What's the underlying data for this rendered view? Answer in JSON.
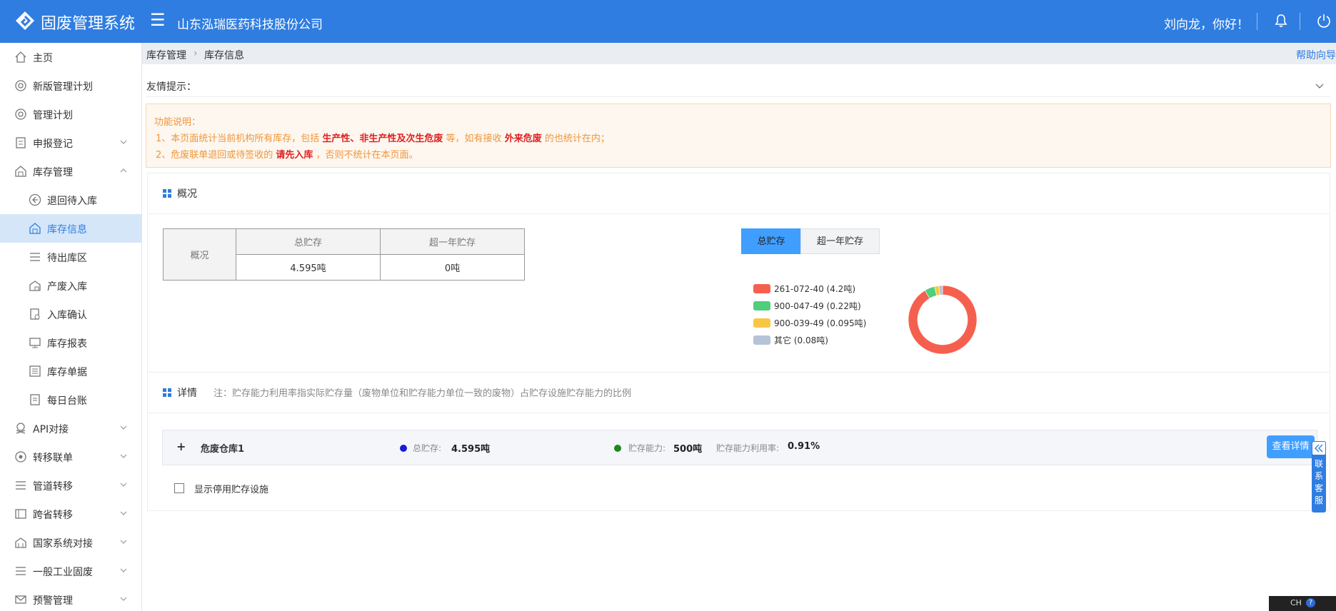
{
  "header": {
    "app_title": "固废管理系统",
    "company": "山东泓瑞医药科技股份公司",
    "greeting": "刘向龙，你好！",
    "icons": [
      "logo-icon",
      "menu-icon",
      "bell-icon",
      "power-icon"
    ],
    "brand_color": "#2f7de1"
  },
  "sidebar": {
    "items": [
      {
        "label": "主页",
        "icon": "home-icon"
      },
      {
        "label": "新版管理计划",
        "icon": "plan-icon"
      },
      {
        "label": "管理计划",
        "icon": "plan-icon"
      },
      {
        "label": "申报登记",
        "icon": "register-icon",
        "expandable": true
      },
      {
        "label": "库存管理",
        "icon": "warehouse-icon",
        "expanded": true
      },
      {
        "label": "退回待入库",
        "icon": "return-icon",
        "sub": true
      },
      {
        "label": "库存信息",
        "icon": "warehouse-icon",
        "sub": true,
        "active": true
      },
      {
        "label": "待出库区",
        "icon": "list-icon",
        "sub": true
      },
      {
        "label": "产废入库",
        "icon": "factory-icon",
        "sub": true
      },
      {
        "label": "入库确认",
        "icon": "confirm-icon",
        "sub": true
      },
      {
        "label": "库存报表",
        "icon": "report-icon",
        "sub": true
      },
      {
        "label": "库存单据",
        "icon": "doc-icon",
        "sub": true
      },
      {
        "label": "每日台账",
        "icon": "ledger-icon",
        "sub": true
      },
      {
        "label": "API对接",
        "icon": "api-icon",
        "expandable": true
      },
      {
        "label": "转移联单",
        "icon": "transfer-icon",
        "expandable": true
      },
      {
        "label": "管道转移",
        "icon": "pipe-icon",
        "expandable": true
      },
      {
        "label": "跨省转移",
        "icon": "cross-province-icon",
        "expandable": true
      },
      {
        "label": "国家系统对接",
        "icon": "national-icon",
        "expandable": true
      },
      {
        "label": "一般工业固废",
        "icon": "industrial-icon",
        "expandable": true
      },
      {
        "label": "预警管理",
        "icon": "alert-icon",
        "expandable": true
      }
    ]
  },
  "breadcrumb": {
    "items": [
      "库存管理",
      "库存信息"
    ],
    "help": "帮助向导"
  },
  "tips": {
    "label": "友情提示：",
    "title": "功能说明：",
    "line1": {
      "a": "1、本页面统计当前机构所有库存，包括 ",
      "b": "生产性、非生产性及次生危废",
      "c": " 等，如有接收 ",
      "d": "外来危废",
      "e": " 的也统计在内；"
    },
    "line2": {
      "a": "2、危废联单退回或待签收的 ",
      "b": "请先入库",
      "c": " ，否则不统计在本页面。"
    },
    "accent": "#f0953a",
    "highlight": "#e02020"
  },
  "overview": {
    "title": "概况",
    "table": {
      "row_label": "概况",
      "headers": [
        "总贮存",
        "超一年贮存"
      ],
      "values": [
        "4.595吨",
        "0吨"
      ]
    },
    "toggle": {
      "on": "总贮存",
      "off": "超一年贮存"
    }
  },
  "chart_data": {
    "type": "pie",
    "categories": [
      "261-072-40",
      "900-047-49",
      "900-039-49",
      "其它"
    ],
    "values": [
      4.2,
      0.22,
      0.095,
      0.08
    ],
    "legend_labels": [
      "261-072-40  (4.2吨)",
      "900-047-49  (0.22吨)",
      "900-039-49  (0.095吨)",
      "其它  (0.08吨)"
    ],
    "colors": [
      "#f5604e",
      "#4fce7c",
      "#f7c744",
      "#b6c2d6"
    ],
    "legend": "left"
  },
  "details": {
    "title": "详情",
    "note": "注：贮存能力利用率指实际贮存量（废物单位和贮存能力单位一致的废物）占贮存设施贮存能力的比例",
    "stores": [
      {
        "expand": "+",
        "name": "危废仓库1",
        "total_label": "总贮存:",
        "total": "4.595吨",
        "capacity_label": "贮存能力:",
        "capacity": "500吨",
        "usage_label": "贮存能力利用率:",
        "usage": "0.91%",
        "button": "查看详情"
      }
    ],
    "show_disabled_label": "显示停用贮存设施",
    "show_disabled_checked": false
  },
  "service": {
    "label": "联系客服"
  },
  "ime": {
    "lang": "CH",
    "help": "?"
  }
}
